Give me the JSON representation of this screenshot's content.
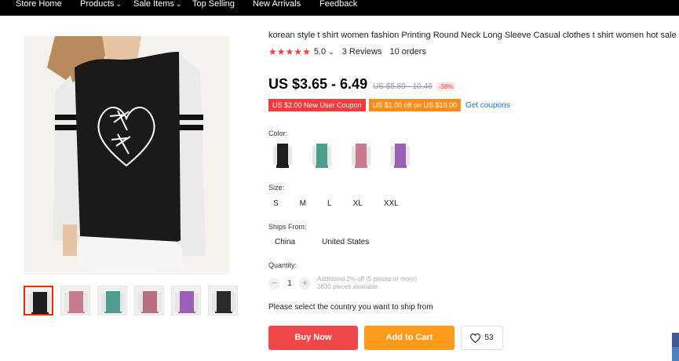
{
  "nav": {
    "items": [
      {
        "label": "Store Home"
      },
      {
        "label": "Products"
      },
      {
        "label": "Sale Items"
      },
      {
        "label": "Top Selling"
      },
      {
        "label": "New Arrivals"
      },
      {
        "label": "Feedback"
      }
    ]
  },
  "product": {
    "title": "korean style t shirt women fashion Printing Round Neck Long Sleeve Casual clothes t shirt women hot sale",
    "rating": "5.0",
    "reviews": "3 Reviews",
    "orders": "10 orders",
    "price": "US $3.65 - 6.49",
    "old_price": "US $5.89 - 10.46",
    "discount": "-38%"
  },
  "coupons": {
    "new_user": "US $2.00 New User Coupon",
    "off": "US $1.00 off on US $19.00",
    "get": "Get coupons"
  },
  "labels": {
    "color": "Color:",
    "size": "Size:",
    "ships_from": "Ships From:",
    "quantity": "Quantity:"
  },
  "colors": [
    "black",
    "green",
    "pink",
    "purple"
  ],
  "sizes": [
    "S",
    "M",
    "L",
    "XL",
    "XXL"
  ],
  "ships_from": [
    "China",
    "United States"
  ],
  "quantity": {
    "minus": "−",
    "value": "1",
    "plus": "+",
    "note1": "Additional 2% off (5 pieces or more)",
    "note2": "2630 pieces available"
  },
  "ship_message": "Please select the country you want to ship from",
  "buttons": {
    "buy": "Buy Now",
    "cart": "Add to Cart",
    "wishlist": "53"
  },
  "palette": {
    "accent_red": "#f04848",
    "accent_orange": "#ff9a1a",
    "link_blue": "#1a73c8",
    "shirt_black": "#1e1e1e",
    "shirt_green": "#4f9d8e",
    "shirt_pink": "#c77b8f",
    "shirt_purple": "#9b5fb5"
  }
}
